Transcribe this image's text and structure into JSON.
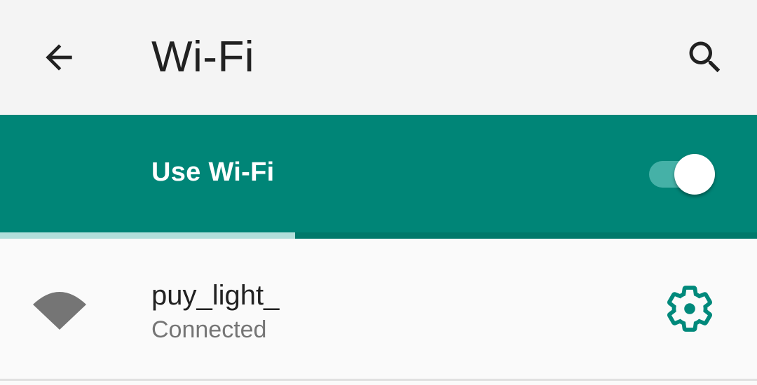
{
  "toolbar": {
    "title": "Wi-Fi",
    "back_icon": "arrow-back-icon",
    "search_icon": "search-icon"
  },
  "master_switch": {
    "label": "Use Wi-Fi",
    "state": "on"
  },
  "scan_progress": {
    "fraction": 0.39
  },
  "networks": [
    {
      "ssid": "puy_light_",
      "status": "Connected",
      "signal_icon": "wifi-signal-icon",
      "settings_icon": "gear-icon"
    }
  ],
  "colors": {
    "accent": "#008577",
    "toolbar_bg": "#f4f4f4",
    "title_text": "#212121",
    "secondary_text": "#757575",
    "gear": "#00897b",
    "signal": "#757575",
    "progress_fill": "#b2dfdb"
  }
}
